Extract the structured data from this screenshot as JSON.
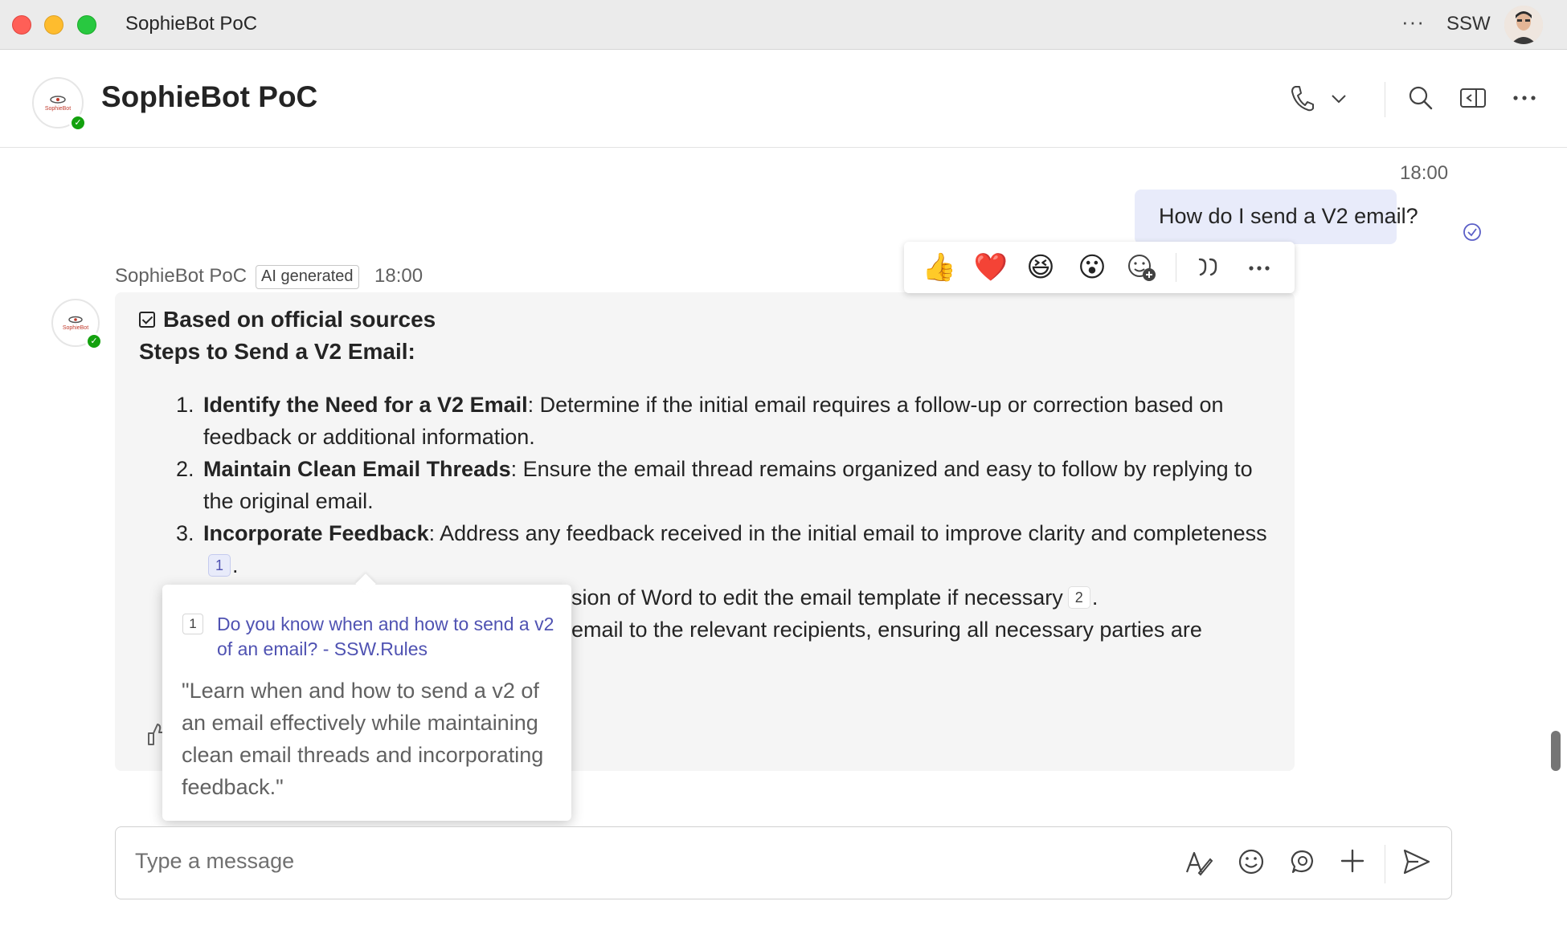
{
  "window": {
    "title": "SophieBot PoC",
    "more": "···",
    "org": "SSW"
  },
  "header": {
    "title": "SophieBot PoC"
  },
  "avatar": {
    "logo_text": "SophieBot"
  },
  "outgoing": {
    "time": "18:00",
    "text": "How do I send a V2 email?"
  },
  "reactions": [
    "👍",
    "❤️",
    "😆",
    "😮"
  ],
  "incoming": {
    "sender": "SophieBot PoC",
    "badge": "AI generated",
    "time": "18:00",
    "sources_label": "Based on official sources",
    "heading": "Steps to Send a V2 Email:",
    "steps": [
      {
        "num": "1.",
        "title": "Identify the Need for a V2 Email",
        "text": ": Determine if the initial email requires a follow-up or correction based on feedback or additional information."
      },
      {
        "num": "2.",
        "title": "Maintain Clean Email Threads",
        "text": ": Ensure the email thread remains organized and easy to follow by replying to the original email."
      },
      {
        "num": "3.",
        "title": "Incorporate Feedback",
        "text": ": Address any feedback received in the initial email to improve clarity and completeness",
        "cite": "1",
        "tail": "."
      },
      {
        "num": "",
        "title": "",
        "text": "sion of Word to edit the email template if necessary",
        "cite": "2",
        "tail": "."
      },
      {
        "num": "",
        "title": "",
        "text": "email to the relevant recipients, ensuring all necessary parties are",
        "cite": "",
        "tail": ""
      }
    ]
  },
  "citation_popup": {
    "num": "1",
    "link": "Do you know when and how to send a v2 of an email? - SSW.Rules",
    "quote": "\"Learn when and how to send a v2 of an email effectively while maintaining clean email threads and incorporating feedback.\""
  },
  "composer": {
    "placeholder": "Type a message"
  },
  "colors": {
    "accent": "#4f52b2",
    "bubble_out": "#e8ebfa",
    "bubble_in": "#f5f5f5",
    "presence": "#13a10e"
  },
  "icons": {
    "header": [
      "phone-icon",
      "chevron-down-icon",
      "search-icon",
      "side-panel-icon",
      "more-icon"
    ],
    "composer": [
      "format-icon",
      "emoji-icon",
      "loop-icon",
      "plus-icon",
      "send-icon"
    ]
  }
}
